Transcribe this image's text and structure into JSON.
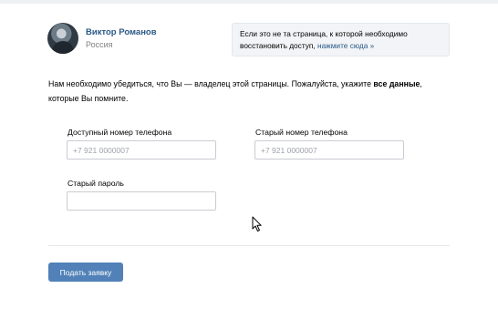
{
  "user": {
    "name": "Виктор Романов",
    "city": "Россия"
  },
  "notice": {
    "text": "Если это не та страница, к которой необходимо восстановить доступ,",
    "link": "нажмите сюда »"
  },
  "intro": {
    "before": "Нам необходимо убедиться, что Вы — владелец этой страницы. Пожалуйста, укажите ",
    "bold": "все данные",
    "after": ", которые Вы помните."
  },
  "form": {
    "phone_label": "Доступный номер телефона",
    "phone_placeholder": "+7 921 0000007",
    "old_phone_label": "Старый номер телефона",
    "old_phone_placeholder": "+7 921 0000007",
    "old_password_label": "Старый пароль",
    "old_password_value": ""
  },
  "submit_label": "Подать заявку",
  "colors": {
    "link": "#2a5885",
    "button": "#5181b8",
    "notice_bg": "#f2f4f7"
  },
  "icons": {
    "cursor": "mouse-pointer-icon"
  }
}
